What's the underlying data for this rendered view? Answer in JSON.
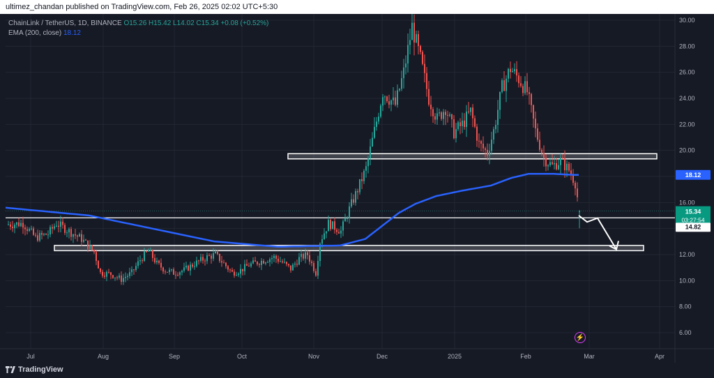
{
  "header": {
    "publisher": "ultimez_chandan published on TradingView.com, Feb 26, 2025 02:02 UTC+5:30"
  },
  "legend": {
    "symbol": "ChainLink / TetherUS, 1D, BINANCE",
    "ohlc": "O15.26  H15.42  L14.02  C15.34  +0.08 (+0.52%)",
    "ema_label": "EMA (200, close)",
    "ema_value": "18.12"
  },
  "price_tags": {
    "ema": "18.12",
    "last": "15.34",
    "countdown": "03:27:54",
    "level": "14.82"
  },
  "branding": {
    "logo_text": "TradingView"
  },
  "icons": {
    "flash": "flash-icon",
    "logo": "tradingview-logo-icon"
  },
  "colors": {
    "bull": "#26a69a",
    "bear": "#ef5350",
    "ema": "#2962ff",
    "zone": "#ffffff",
    "background": "#161a25"
  },
  "chart_data": {
    "type": "candlestick",
    "symbol": "ChainLink / TetherUS",
    "interval": "1D",
    "exchange": "BINANCE",
    "ylim": [
      5,
      31
    ],
    "yticks": [
      "30.00",
      "28.00",
      "26.00",
      "24.00",
      "22.00",
      "20.00",
      "18.00",
      "16.00",
      "14.00",
      "12.00",
      "10.00",
      "8.00",
      "6.00"
    ],
    "xticks": [
      "Jul",
      "Aug",
      "Sep",
      "Oct",
      "Nov",
      "Dec",
      "2025",
      "Feb",
      "Mar",
      "Apr"
    ],
    "price_path": [
      [
        0,
        14.3
      ],
      [
        8,
        14.4
      ],
      [
        14,
        13.3
      ],
      [
        20,
        13.6
      ],
      [
        24,
        14.4
      ],
      [
        30,
        13.8
      ],
      [
        36,
        13.2
      ],
      [
        42,
        12.2
      ],
      [
        45,
        10.6
      ],
      [
        50,
        10.5
      ],
      [
        55,
        10.1
      ],
      [
        60,
        10.6
      ],
      [
        64,
        11.6
      ],
      [
        68,
        12.3
      ],
      [
        72,
        11.3
      ],
      [
        76,
        10.8
      ],
      [
        80,
        10.6
      ],
      [
        85,
        10.8
      ],
      [
        90,
        11.3
      ],
      [
        96,
        11.8
      ],
      [
        100,
        12.0
      ],
      [
        104,
        11.3
      ],
      [
        108,
        10.6
      ],
      [
        112,
        10.8
      ],
      [
        116,
        11.2
      ],
      [
        122,
        11.5
      ],
      [
        128,
        11.8
      ],
      [
        132,
        11.4
      ],
      [
        136,
        10.9
      ],
      [
        140,
        11.7
      ],
      [
        144,
        12.0
      ],
      [
        148,
        10.6
      ],
      [
        150,
        13.0
      ],
      [
        154,
        14.4
      ],
      [
        160,
        13.8
      ],
      [
        164,
        15.5
      ],
      [
        168,
        17.0
      ],
      [
        172,
        18.6
      ],
      [
        176,
        21.5
      ],
      [
        180,
        24.5
      ],
      [
        186,
        23.5
      ],
      [
        190,
        26.0
      ],
      [
        194,
        29.5
      ],
      [
        198,
        27.0
      ],
      [
        202,
        24.0
      ],
      [
        206,
        22.4
      ],
      [
        210,
        23.3
      ],
      [
        214,
        21.4
      ],
      [
        218,
        22.0
      ],
      [
        222,
        23.0
      ],
      [
        226,
        20.5
      ],
      [
        230,
        19.8
      ],
      [
        233,
        21.5
      ],
      [
        237,
        24.8
      ],
      [
        241,
        26.3
      ],
      [
        245,
        25.5
      ],
      [
        249,
        24.5
      ],
      [
        253,
        21.5
      ],
      [
        257,
        19.4
      ],
      [
        261,
        18.8
      ],
      [
        265,
        19.2
      ],
      [
        269,
        18.5
      ],
      [
        272,
        17.5
      ],
      [
        274,
        15.34
      ]
    ],
    "ema200": [
      [
        0,
        15.6
      ],
      [
        40,
        15.0
      ],
      [
        70,
        14.0
      ],
      [
        100,
        13.0
      ],
      [
        130,
        12.6
      ],
      [
        160,
        12.7
      ],
      [
        172,
        13.2
      ],
      [
        180,
        14.2
      ],
      [
        188,
        15.2
      ],
      [
        196,
        15.9
      ],
      [
        206,
        16.5
      ],
      [
        218,
        16.9
      ],
      [
        232,
        17.3
      ],
      [
        242,
        17.9
      ],
      [
        250,
        18.2
      ],
      [
        262,
        18.2
      ],
      [
        272,
        18.12
      ]
    ],
    "zones": [
      {
        "label": "resistance",
        "from": 19.35,
        "to": 19.75
      },
      {
        "label": "support",
        "from": 12.3,
        "to": 12.7
      }
    ],
    "horizontal_line": 14.82,
    "projection_arrow": [
      [
        274,
        15.0
      ],
      [
        278,
        14.5
      ],
      [
        283,
        14.8
      ],
      [
        292,
        12.4
      ],
      [
        294,
        13.0
      ]
    ]
  }
}
